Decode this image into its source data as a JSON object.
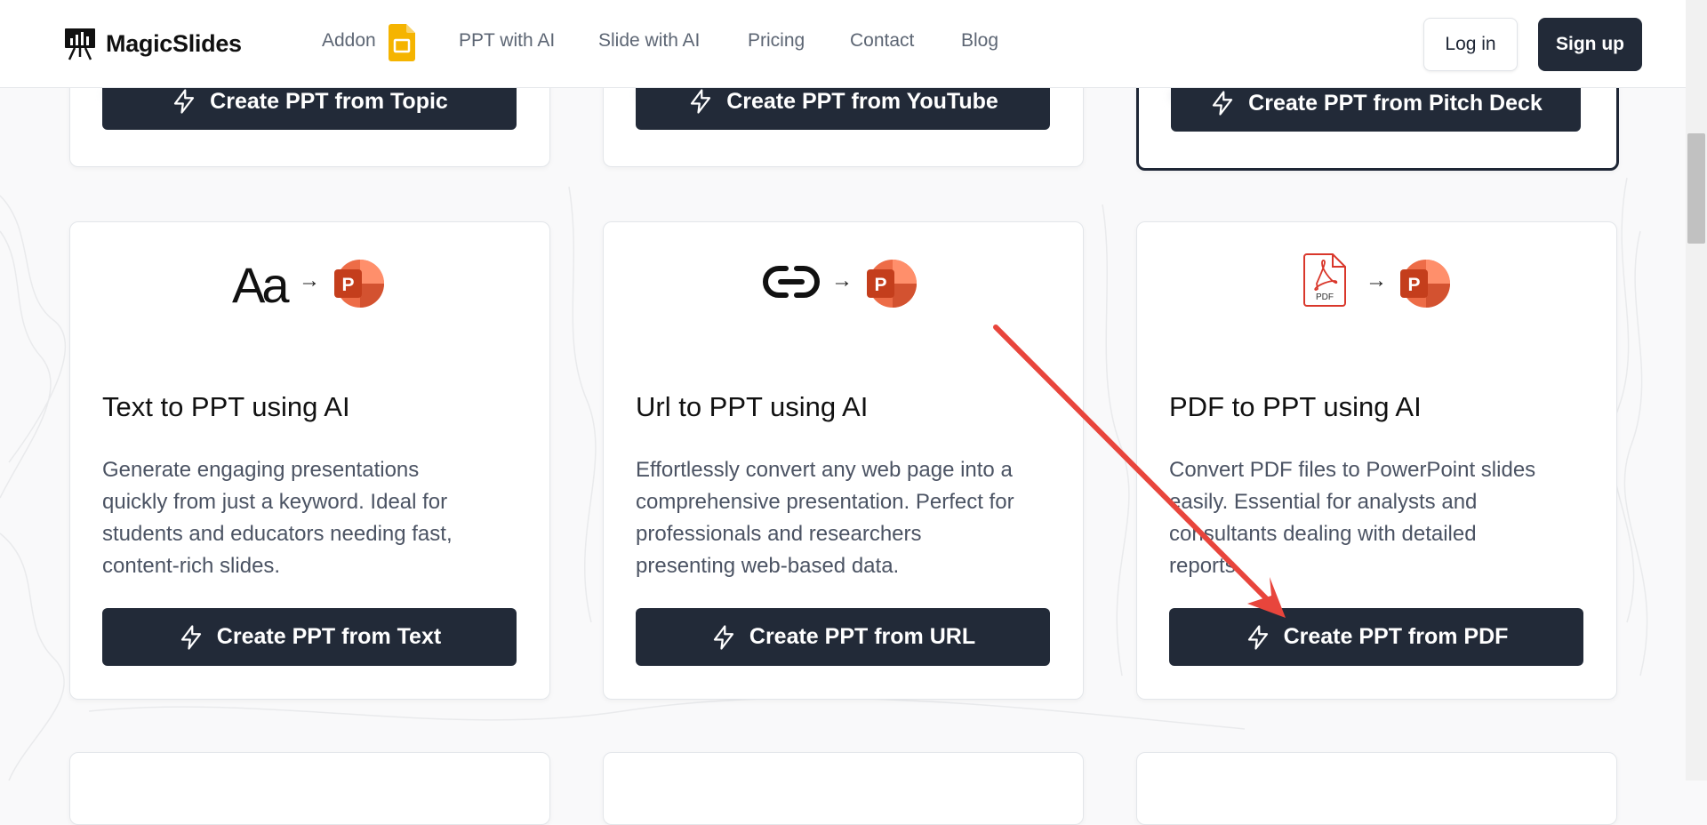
{
  "header": {
    "logo_text": "MagicSlides",
    "nav": {
      "addon": "Addon",
      "ppt_with_ai": "PPT with AI",
      "slide_with_ai": "Slide with AI",
      "pricing": "Pricing",
      "contact": "Contact",
      "blog": "Blog"
    },
    "login": "Log in",
    "signup": "Sign up"
  },
  "top_row": {
    "topic_button": "Create PPT from Topic",
    "youtube_button": "Create PPT from YouTube",
    "pitch_button": "Create PPT from Pitch Deck"
  },
  "cards": {
    "text": {
      "icon_text": "Aa",
      "arrow": "→",
      "title": "Text to PPT using AI",
      "desc_lines": [
        "Generate engaging presentations",
        "quickly from just a keyword. Ideal for",
        "students and educators needing fast,",
        "content-rich slides."
      ],
      "button": "Create PPT from Text"
    },
    "url": {
      "arrow": "→",
      "title": "Url to PPT using AI",
      "desc_lines": [
        "Effortlessly convert any web page into a",
        "comprehensive presentation. Perfect for",
        "professionals and researchers",
        "presenting web-based data."
      ],
      "button": "Create PPT from URL"
    },
    "pdf": {
      "pdf_label": "PDF",
      "arrow": "→",
      "title": "PDF to PPT using AI",
      "desc_lines": [
        "Convert PDF files to PowerPoint slides",
        "easily. Essential for analysts and",
        "consultants dealing with detailed",
        "reports."
      ],
      "button": "Create PPT from PDF"
    }
  },
  "ppt_logo_letter": "P",
  "colors": {
    "dark": "#222a38",
    "ppt_orange": "#d9472b",
    "annotation_red": "#e8453c",
    "addon_yellow": "#f5b400"
  },
  "icons": [
    "lightning-icon",
    "powerpoint-icon",
    "link-icon",
    "pdf-icon",
    "google-slides-icon",
    "presentation-logo-icon"
  ]
}
